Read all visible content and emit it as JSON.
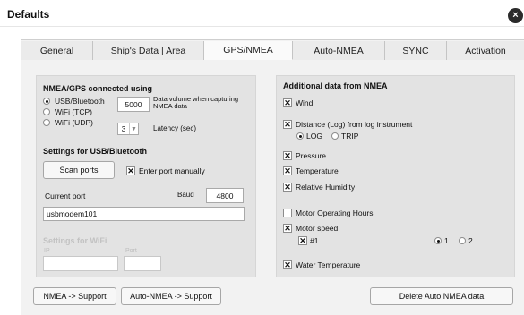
{
  "window": {
    "title": "Defaults",
    "close_icon": "×"
  },
  "tabs": [
    {
      "label": "General"
    },
    {
      "label": "Ship's Data  | Area"
    },
    {
      "label": "GPS/NMEA"
    },
    {
      "label": "Auto-NMEA"
    },
    {
      "label": "SYNC"
    },
    {
      "label": "Activation"
    }
  ],
  "nmea_gps": {
    "title": "NMEA/GPS connected using",
    "options": [
      "USB/Bluetooth",
      "WiFi (TCP)",
      "WiFi (UDP)"
    ],
    "selected": "USB/Bluetooth",
    "data_volume": {
      "value": "5000",
      "label": "Data volume when capturing NMEA data"
    },
    "latency": {
      "value": "3",
      "label": "Latency (sec)"
    }
  },
  "usb_settings": {
    "title": "Settings for USB/Bluetooth",
    "scan_button": "Scan ports",
    "enter_manually": {
      "label": "Enter port manually",
      "checked": true
    },
    "current_port_label": "Current port",
    "current_port_value": "usbmodem101",
    "baud_label": "Baud",
    "baud_value": "4800"
  },
  "wifi_settings": {
    "title": "Settings for WiFi",
    "ip_label": "IP",
    "port_label": "Port"
  },
  "additional": {
    "title": "Additional data from NMEA",
    "wind": {
      "label": "Wind",
      "checked": true
    },
    "distance": {
      "label": "Distance (Log) from log instrument",
      "checked": true
    },
    "log_option": "LOG",
    "trip_option": "TRIP",
    "pressure": {
      "label": "Pressure",
      "checked": true
    },
    "temperature": {
      "label": "Temperature",
      "checked": true
    },
    "humidity": {
      "label": "Relative Humidity",
      "checked": true
    },
    "motor_hours": {
      "label": "Motor Operating Hours",
      "checked": false
    },
    "motor_speed": {
      "label": "Motor speed",
      "checked": true
    },
    "motor_1": {
      "label": "#1",
      "checked": true
    },
    "engine_opt1": "1",
    "engine_opt2": "2",
    "water_temp": {
      "label": "Water Temperature",
      "checked": true
    }
  },
  "bottom_buttons": {
    "nmea_support": "NMEA -> Support",
    "auto_nmea_support": "Auto-NMEA -> Support",
    "delete_auto_nmea": "Delete Auto NMEA data"
  },
  "icons": {
    "close": "close-icon",
    "check": "check-icon",
    "dropdown": "chevron-down-icon"
  },
  "colors": {
    "panel": "#e3e3e3",
    "window_bg": "#f2f2f2",
    "active_tab": "#fafafa"
  }
}
